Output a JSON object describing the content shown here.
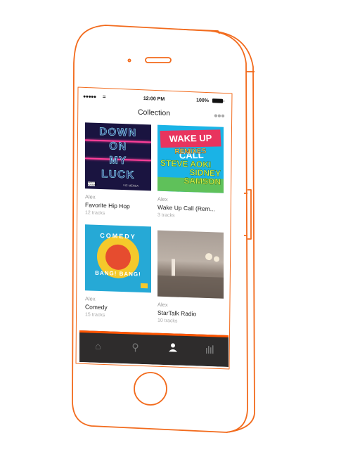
{
  "status_bar": {
    "signal": "●●●●●",
    "time": "12:00 PM",
    "battery": "100%"
  },
  "nav": {
    "title": "Collection",
    "more_icon": "more-dots-icon"
  },
  "playlists": [
    {
      "owner": "Alex",
      "title": "Favorite Hip Hop",
      "tracks": "12 tracks",
      "cover": {
        "lines": [
          "DOWN",
          "ON",
          "MY",
          "LUCK"
        ],
        "artist": "VIC MENSA",
        "advisory": "PARENTAL ADVISORY"
      }
    },
    {
      "owner": "Alex",
      "title": "Wake Up Call (Rem...",
      "tracks": "3 tracks",
      "cover": {
        "headline": "WAKE UP CALL",
        "subtitle": "REMIXES",
        "artists": [
          "STEVE AOKI",
          "SIDNEY SAMSON"
        ]
      }
    },
    {
      "owner": "Alex",
      "title": "Comedy",
      "tracks": "15 tracks",
      "cover": {
        "top": "COMEDY",
        "bottom": "BANG! BANG!"
      }
    },
    {
      "owner": "Alex",
      "title": "StarTalk Radio",
      "tracks": "10 tracks",
      "cover": {}
    }
  ],
  "tab_bar": {
    "tabs": [
      {
        "icon": "home-icon",
        "glyph": "⌂"
      },
      {
        "icon": "search-icon",
        "glyph": "⚲"
      },
      {
        "icon": "user-icon",
        "glyph": "👤"
      },
      {
        "icon": "stream-icon",
        "glyph": "⫼"
      }
    ],
    "active_index": 2
  },
  "colors": {
    "outline": "#f26b1d",
    "accent": "#ff5500",
    "tab_bar_bg": "#2e2c2c"
  }
}
